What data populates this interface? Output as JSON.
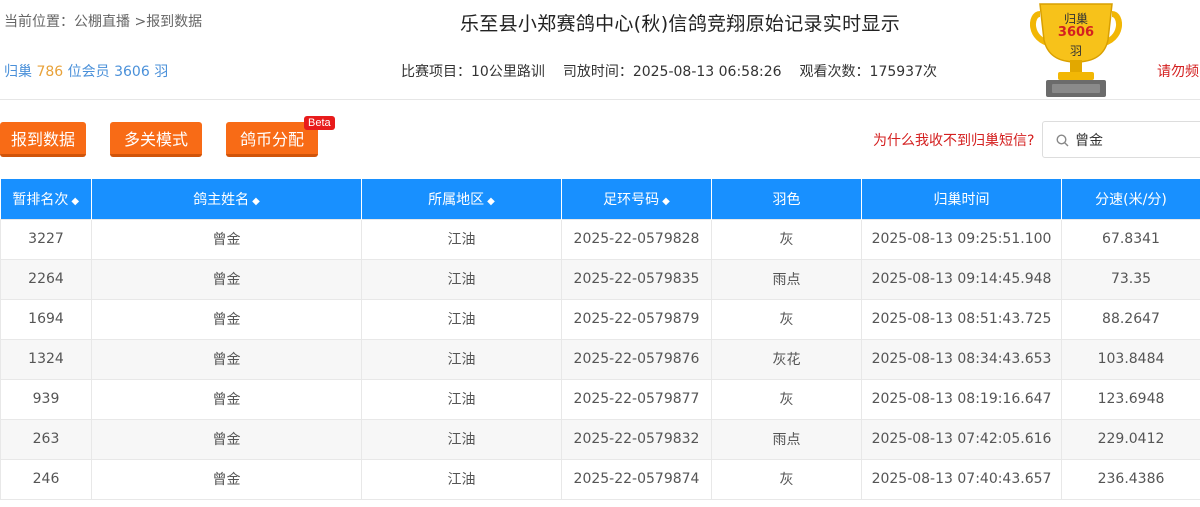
{
  "breadcrumb": {
    "prefix": "当前位置：",
    "link1": "公棚直播",
    "sep": " >",
    "link2": "报到数据"
  },
  "title": "乐至县小郑赛鸽中心(秋)信鸽竞翔原始记录实时显示",
  "stats": {
    "label1": "归巢",
    "returned": "786",
    "label2": "位会员",
    "count": "3606",
    "label3": "羽"
  },
  "race": {
    "project_label": "比赛项目：",
    "project": "10公里路训",
    "release_label": "司放时间：",
    "release_time": "2025-08-13 06:58:26",
    "views_label": "观看次数：",
    "views": "175937次"
  },
  "trophy": {
    "line1": "归巢",
    "line2": "3606",
    "line3": "羽"
  },
  "warning": "请勿频",
  "buttons": {
    "report": "报到数据",
    "multi": "多关模式",
    "coin": "鸽币分配",
    "beta": "Beta"
  },
  "sms_link": "为什么我收不到归巢短信?",
  "search": {
    "value": "曾金"
  },
  "colors": {
    "header_bg": "#1890ff",
    "button_bg": "#f86b16",
    "alert": "#d42020"
  },
  "table": {
    "headers": [
      "暂排名次",
      "鸽主姓名",
      "所属地区",
      "足环号码",
      "羽色",
      "归巢时间",
      "分速(米/分)"
    ],
    "rows": [
      [
        "3227",
        "曾金",
        "江油",
        "2025-22-0579828",
        "灰",
        "2025-08-13 09:25:51.100",
        "67.8341"
      ],
      [
        "2264",
        "曾金",
        "江油",
        "2025-22-0579835",
        "雨点",
        "2025-08-13 09:14:45.948",
        "73.35"
      ],
      [
        "1694",
        "曾金",
        "江油",
        "2025-22-0579879",
        "灰",
        "2025-08-13 08:51:43.725",
        "88.2647"
      ],
      [
        "1324",
        "曾金",
        "江油",
        "2025-22-0579876",
        "灰花",
        "2025-08-13 08:34:43.653",
        "103.8484"
      ],
      [
        "939",
        "曾金",
        "江油",
        "2025-22-0579877",
        "灰",
        "2025-08-13 08:19:16.647",
        "123.6948"
      ],
      [
        "263",
        "曾金",
        "江油",
        "2025-22-0579832",
        "雨点",
        "2025-08-13 07:42:05.616",
        "229.0412"
      ],
      [
        "246",
        "曾金",
        "江油",
        "2025-22-0579874",
        "灰",
        "2025-08-13 07:40:43.657",
        "236.4386"
      ]
    ]
  }
}
